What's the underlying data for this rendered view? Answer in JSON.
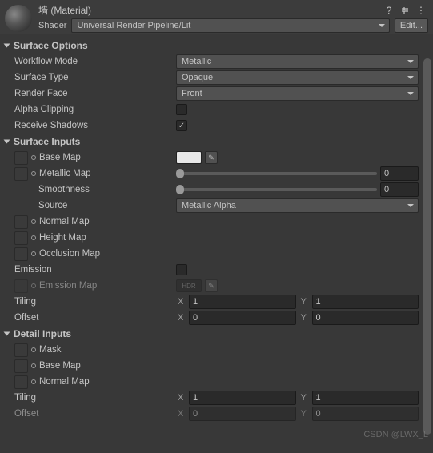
{
  "header": {
    "title": "墙 (Material)",
    "shader_label": "Shader",
    "shader_value": "Universal Render Pipeline/Lit",
    "edit_btn": "Edit..."
  },
  "sections": {
    "surface_options": {
      "title": "Surface Options",
      "workflow_mode": {
        "label": "Workflow Mode",
        "value": "Metallic"
      },
      "surface_type": {
        "label": "Surface Type",
        "value": "Opaque"
      },
      "render_face": {
        "label": "Render Face",
        "value": "Front"
      },
      "alpha_clipping": {
        "label": "Alpha Clipping",
        "checked": false
      },
      "receive_shadows": {
        "label": "Receive Shadows",
        "checked": true
      }
    },
    "surface_inputs": {
      "title": "Surface Inputs",
      "base_map": "Base Map",
      "metallic_map": "Metallic Map",
      "metallic_value": "0",
      "smoothness": "Smoothness",
      "smoothness_value": "0",
      "source": "Source",
      "source_value": "Metallic Alpha",
      "normal_map": "Normal Map",
      "height_map": "Height Map",
      "occlusion_map": "Occlusion Map",
      "emission": "Emission",
      "emission_map": "Emission Map",
      "hdr_label": "HDR",
      "tiling": "Tiling",
      "tiling_x": "1",
      "tiling_y": "1",
      "offset": "Offset",
      "offset_x": "0",
      "offset_y": "0"
    },
    "detail_inputs": {
      "title": "Detail Inputs",
      "mask": "Mask",
      "base_map": "Base Map",
      "normal_map": "Normal Map",
      "tiling": "Tiling",
      "tiling_x": "1",
      "tiling_y": "1",
      "offset": "Offset",
      "offset_x": "0",
      "offset_y": "0"
    }
  },
  "labels": {
    "x": "X",
    "y": "Y"
  },
  "watermark": "CSDN @LWX_L"
}
